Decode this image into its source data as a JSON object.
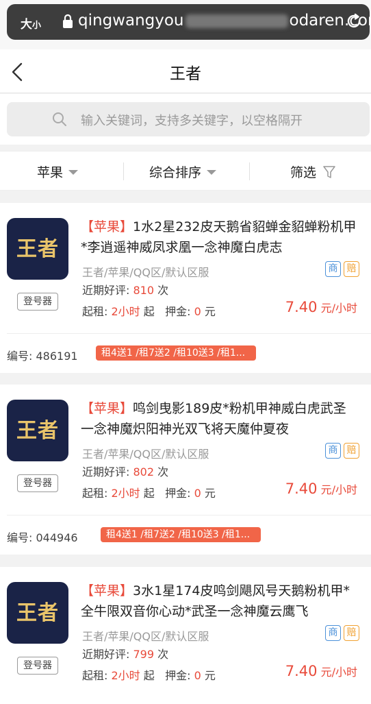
{
  "browser": {
    "text_size": "大",
    "text_size_small": "小",
    "url_left": "qingwangyou",
    "url_right": "odaren.com"
  },
  "header": {
    "title": "王者"
  },
  "search": {
    "placeholder": "输入关键词，支持多关键字，以空格隔开"
  },
  "filters": {
    "platform": "苹果",
    "sort": "综合排序",
    "filter": "筛选"
  },
  "listings": [
    {
      "tag": "【苹果】",
      "title": "1水2星232皮天鹅省貂蝉金貂蝉粉机甲*李逍遥神威凤求凰一念神魔白虎志",
      "logo": "王者",
      "login_label": "登号器",
      "meta": "王者/苹果/QQ区/默认区服",
      "badge_1": "商",
      "badge_2": "赔",
      "rating_label": "近期好评:",
      "rating_value": "810",
      "rating_unit": "次",
      "min_label": "起租:",
      "min_value": "2小时",
      "min_suffix": "起",
      "deposit_label": "押金:",
      "deposit_value": "0",
      "deposit_unit": "元",
      "price": "7.40",
      "price_unit": "元/小时",
      "code_label": "编号:",
      "code": "486191",
      "promo": "租4送1 /租7送2 /租10送3 /租1..."
    },
    {
      "tag": "【苹果】",
      "title": "鸣剑曳影189皮*粉机甲神威白虎武圣一念神魔炽阳神光双飞将天魔仲夏夜",
      "logo": "王者",
      "login_label": "登号器",
      "meta": "王者/苹果/QQ区/默认区服",
      "badge_1": "商",
      "badge_2": "赔",
      "rating_label": "近期好评:",
      "rating_value": "802",
      "rating_unit": "次",
      "min_label": "起租:",
      "min_value": "2小时",
      "min_suffix": "起",
      "deposit_label": "押金:",
      "deposit_value": "0",
      "deposit_unit": "元",
      "price": "7.40",
      "price_unit": "元/小时",
      "code_label": "编号:",
      "code": "044946",
      "promo": "租4送1 /租7送2 /租10送3 /租1..."
    },
    {
      "tag": "【苹果】",
      "title": "3水1星174皮鸣剑飓风号天鹅粉机甲*全牛限双音你心动*武圣一念神魔云鹰飞",
      "logo": "王者",
      "login_label": "登号器",
      "meta": "王者/苹果/QQ区/默认区服",
      "badge_1": "商",
      "badge_2": "赔",
      "rating_label": "近期好评:",
      "rating_value": "799",
      "rating_unit": "次",
      "min_label": "起租:",
      "min_value": "2小时",
      "min_suffix": "起",
      "deposit_label": "押金:",
      "deposit_value": "0",
      "deposit_unit": "元",
      "price": "7.40",
      "price_unit": "元/小时"
    }
  ],
  "colors": {
    "accent": "#e84a3a",
    "promo_bg": "#f16548",
    "logo_bg": "#1a2347",
    "logo_text": "#e9c46a"
  }
}
